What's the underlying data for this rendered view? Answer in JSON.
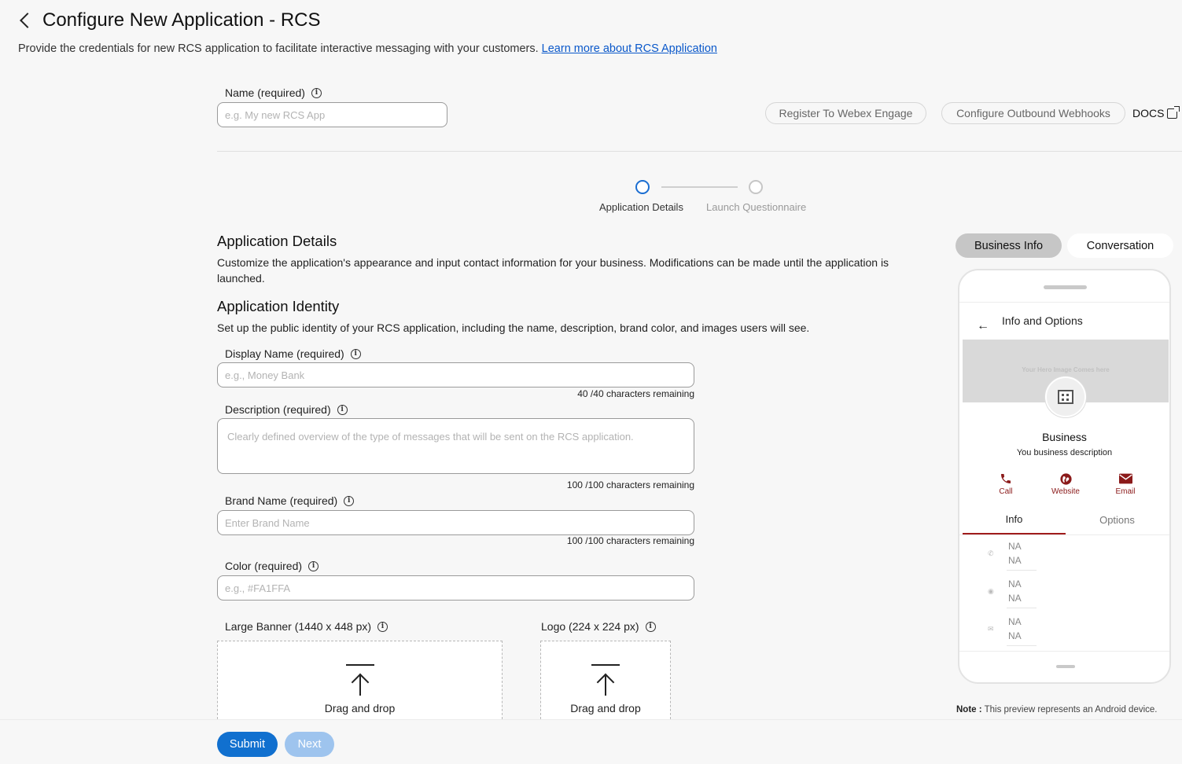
{
  "header": {
    "title": "Configure New Application - RCS",
    "subtitle": "Provide the credentials for new RCS application to facilitate interactive messaging with your customers.",
    "learn_more": "Learn more about RCS Application"
  },
  "top_form": {
    "name_label": "Name (required)",
    "name_placeholder": "e.g. My new RCS App",
    "register_button": "Register To Webex Engage",
    "webhooks_button": "Configure Outbound Webhooks",
    "docs": "DOCS"
  },
  "stepper": {
    "steps": [
      {
        "label": "Application Details"
      },
      {
        "label": "Launch Questionnaire"
      }
    ]
  },
  "details": {
    "title": "Application Details",
    "desc": "Customize the application's appearance and input contact information for your business. Modifications can be made until the application is launched."
  },
  "identity": {
    "title": "Application Identity",
    "desc": "Set up the public identity of your RCS application, including the name, description, brand color, and images users will see."
  },
  "fields": {
    "display_name": {
      "label": "Display Name (required)",
      "placeholder": "e.g., Money Bank",
      "counter": "40 /40 characters remaining"
    },
    "description": {
      "label": "Description (required)",
      "placeholder": "Clearly defined overview of the type of messages that will be sent on the RCS application.",
      "counter": "100 /100 characters remaining"
    },
    "brand_name": {
      "label": "Brand Name (required)",
      "placeholder": "Enter Brand Name",
      "counter": "100 /100 characters remaining"
    },
    "color": {
      "label": "Color (required)",
      "placeholder": "e.g., #FA1FFA"
    }
  },
  "uploads": {
    "banner_label": "Large Banner (1440 x 448 px)",
    "logo_label": "Logo (224 x 224 px)",
    "drag_text": "Drag and drop"
  },
  "footer": {
    "submit": "Submit",
    "next": "Next"
  },
  "preview": {
    "toggle_business": "Business Info",
    "toggle_conversation": "Conversation",
    "screen_title": "Info and Options",
    "hero_text": "Your Hero Image Comes here",
    "business_name": "Business",
    "business_desc": "You business description",
    "actions": [
      {
        "label": "Call",
        "icon": "phone-icon"
      },
      {
        "label": "Website",
        "icon": "globe-icon"
      },
      {
        "label": "Email",
        "icon": "mail-icon"
      }
    ],
    "tab_info": "Info",
    "tab_options": "Options",
    "rows": [
      {
        "icon": "phone-icon",
        "line1": "NA",
        "line2": "NA"
      },
      {
        "icon": "globe-icon",
        "line1": "NA",
        "line2": "NA"
      },
      {
        "icon": "mail-icon",
        "line1": "NA",
        "line2": "NA"
      }
    ],
    "note_label": "Note :",
    "note_text": "This preview represents an Android device."
  },
  "colors": {
    "primary": "#1170cf",
    "primary_disabled": "#9ec4ee",
    "accent_red": "#a01c1c",
    "link": "#0a58ca"
  }
}
